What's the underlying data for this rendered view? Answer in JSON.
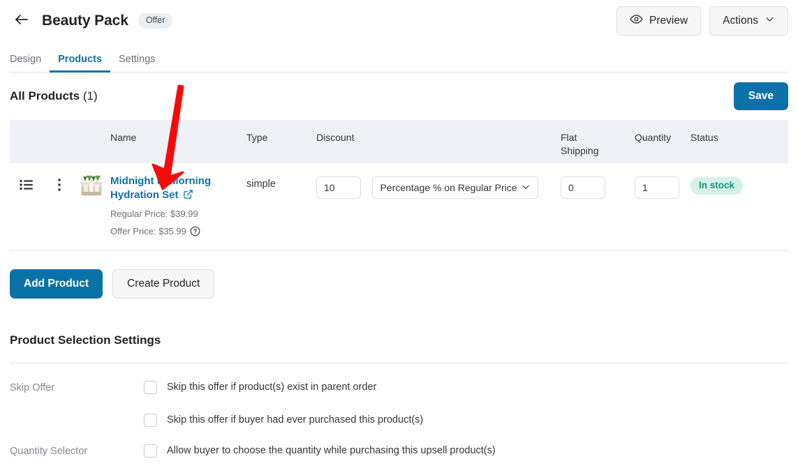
{
  "header": {
    "back_icon": "arrow-left-icon",
    "title": "Beauty Pack",
    "badge": "Offer",
    "preview_label": "Preview",
    "preview_icon": "eye-icon",
    "actions_label": "Actions",
    "actions_icon": "chevron-down-icon"
  },
  "tabs": [
    {
      "label": "Design",
      "active": false
    },
    {
      "label": "Products",
      "active": true
    },
    {
      "label": "Settings",
      "active": false
    }
  ],
  "products_section": {
    "title": "All Products",
    "count": "(1)",
    "save_label": "Save"
  },
  "table": {
    "columns": {
      "name": "Name",
      "type": "Type",
      "discount": "Discount",
      "flat_shipping_line1": "Flat",
      "flat_shipping_line2": "Shipping",
      "quantity": "Quantity",
      "status": "Status"
    },
    "rows": [
      {
        "drag_icon": "drag-list-icon",
        "menu_icon": "kebab-menu-icon",
        "thumbnail_icon": "product-thumbnail",
        "name": "Midnight to Morning Hydration Set",
        "external_link_icon": "external-link-icon",
        "regular_price": "Regular Price: $39.99",
        "offer_price": "Offer Price: $35.99",
        "help_icon": "help-circle-icon",
        "type": "simple",
        "discount_value": "10",
        "discount_type": "Percentage % on Regular Price",
        "discount_type_icon": "chevron-down-icon",
        "flat_shipping": "0",
        "quantity": "1",
        "status": "In stock"
      }
    ]
  },
  "actions": {
    "add_product": "Add Product",
    "create_product": "Create Product"
  },
  "settings": {
    "title": "Product Selection Settings",
    "rows": [
      {
        "label": "Skip Offer",
        "checkboxes": [
          {
            "label": "Skip this offer if product(s) exist in parent order",
            "checked": false
          },
          {
            "label": "Skip this offer if buyer had ever purchased this product(s)",
            "checked": false
          }
        ]
      },
      {
        "label": "Quantity Selector",
        "checkboxes": [
          {
            "label": "Allow buyer to choose the quantity while purchasing this upsell product(s)",
            "checked": false
          }
        ]
      }
    ]
  },
  "annotation": {
    "arrow_icon": "red-arrow-annotation",
    "color": "#f60b0b"
  },
  "colors": {
    "accent": "#0b72a8",
    "header_bg": "#f0f0f7",
    "stock_bg": "#d6f2e8",
    "stock_text": "#15907a"
  }
}
